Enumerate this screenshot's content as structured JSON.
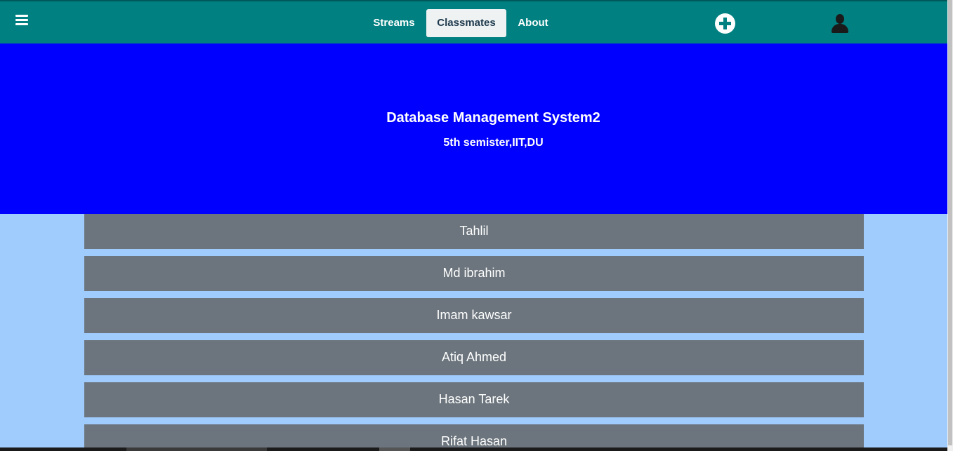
{
  "nav": {
    "links": [
      {
        "label": "Streams"
      },
      {
        "label": "Classmates",
        "active": true
      },
      {
        "label": "About"
      }
    ],
    "icons": {
      "menu": "hamburger-menu-icon",
      "add": "plus-circle-icon",
      "user": "user-account-icon"
    }
  },
  "hero": {
    "title": "Database Management System2",
    "subtitle": "5th semister,IIT,DU"
  },
  "classmates": [
    {
      "name": "Tahlil"
    },
    {
      "name": "Md ibrahim"
    },
    {
      "name": "Imam kawsar"
    },
    {
      "name": "Atiq Ahmed"
    },
    {
      "name": "Hasan Tarek"
    },
    {
      "name": "Rifat Hasan"
    }
  ],
  "colors": {
    "navbar": "#008080",
    "hero": "#0000ff",
    "page_background": "#9fcbfd",
    "list_item": "#6c757d",
    "active_tab": "#eef2f3"
  }
}
